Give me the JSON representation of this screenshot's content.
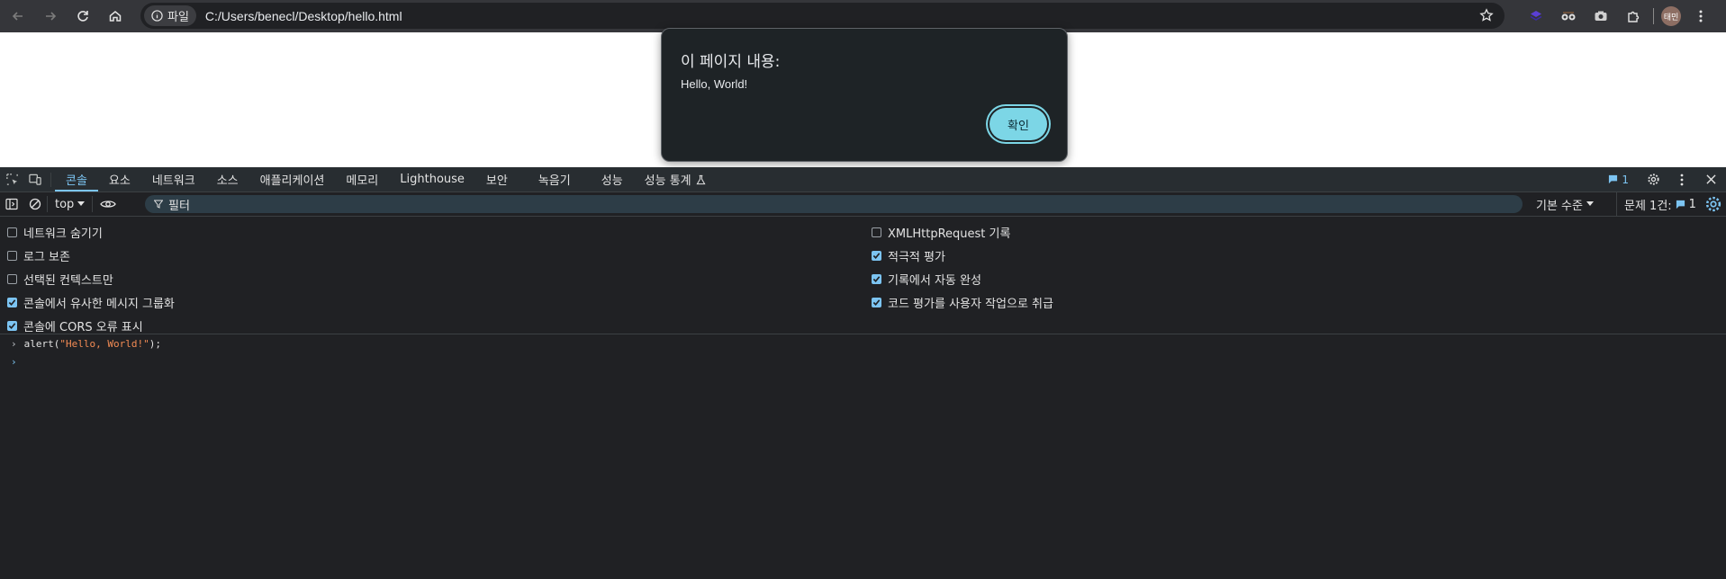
{
  "browser": {
    "site_chip_label": "파일",
    "url": "C:/Users/benecl/Desktop/hello.html",
    "profile_initials": "태민"
  },
  "alert": {
    "title": "이 페이지 내용:",
    "message": "Hello, World!",
    "ok_label": "확인"
  },
  "devtools": {
    "tabs": [
      {
        "label": "콘솔",
        "active": true
      },
      {
        "label": "요소"
      },
      {
        "label": "네트워크"
      },
      {
        "label": "소스"
      },
      {
        "label": "애플리케이션"
      },
      {
        "label": "메모리"
      },
      {
        "label": "Lighthouse"
      },
      {
        "label": "보안"
      },
      {
        "label": "녹음기"
      },
      {
        "label": "성능"
      },
      {
        "label": "성능 통계"
      }
    ],
    "message_badge_count": "1",
    "context": "top",
    "filter_placeholder": "필터",
    "level_label": "기본 수준",
    "issues_label": "문제 1건:",
    "issues_count": "1",
    "settings_left": [
      {
        "label": "네트워크 숨기기",
        "checked": false
      },
      {
        "label": "로그 보존",
        "checked": false
      },
      {
        "label": "선택된 컨텍스트만",
        "checked": false
      },
      {
        "label": "콘솔에서 유사한 메시지 그룹화",
        "checked": true
      },
      {
        "label": "콘솔에 CORS 오류 표시",
        "checked": true
      }
    ],
    "settings_right": [
      {
        "label": "XMLHttpRequest 기록",
        "checked": false
      },
      {
        "label": "적극적 평가",
        "checked": true
      },
      {
        "label": "기록에서 자동 완성",
        "checked": true
      },
      {
        "label": "코드 평가를 사용자 작업으로 취급",
        "checked": true
      }
    ],
    "console": {
      "input_prefix": "alert(",
      "input_string": "\"Hello, World!\"",
      "input_suffix": ");"
    }
  },
  "colors": {
    "accent": "#7cc4f2",
    "alert_button": "#7cd6e6",
    "string": "#f28b54"
  }
}
